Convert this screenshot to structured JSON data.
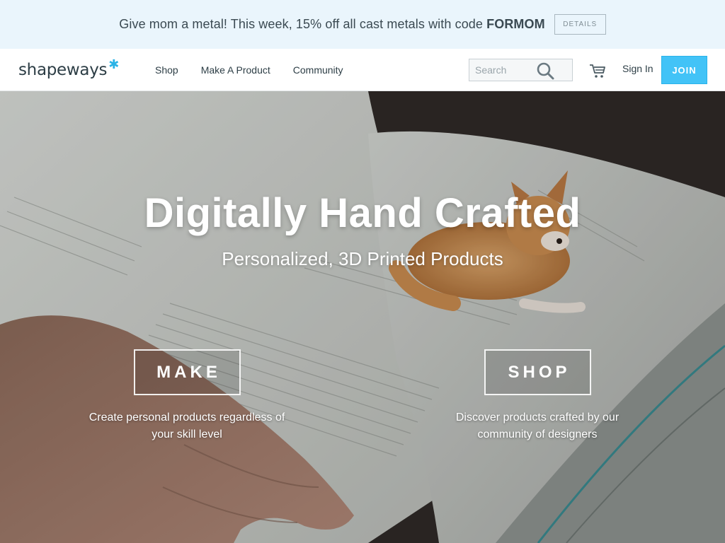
{
  "promo": {
    "text_prefix": "Give mom a metal! This week, 15% off all cast metals with code ",
    "code": "FORMOM",
    "details_label": "DETAILS"
  },
  "nav": {
    "logo": "shapeways",
    "links": [
      {
        "label": "Shop"
      },
      {
        "label": "Make A Product"
      },
      {
        "label": "Community"
      }
    ],
    "search_placeholder": "Search",
    "signin_label": "Sign In",
    "join_label": "JOIN"
  },
  "hero": {
    "title": "Digitally Hand Crafted",
    "subtitle": "Personalized, 3D Printed Products",
    "make": {
      "label": "MAKE",
      "description": "Create personal products regardless of your skill level"
    },
    "shop": {
      "label": "SHOP",
      "description": "Discover products crafted by our community of designers"
    }
  },
  "colors": {
    "accent": "#42c3f7",
    "promo_bg": "#eaf5fc",
    "text_dark": "#2d3e46"
  }
}
